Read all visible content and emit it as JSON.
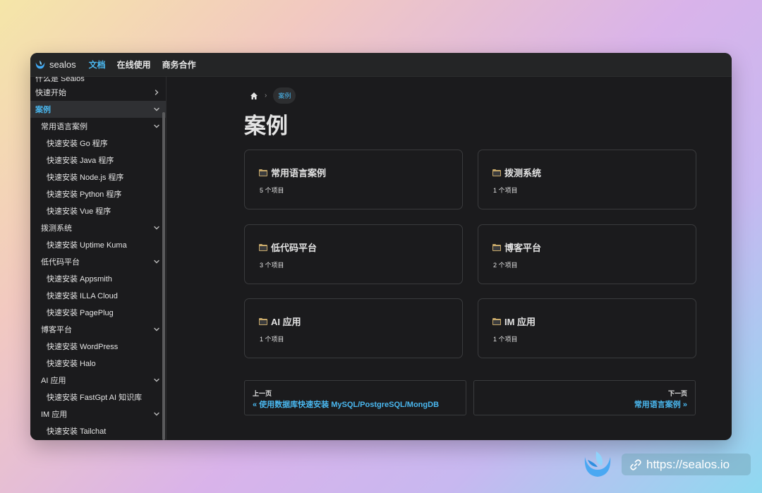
{
  "navbar": {
    "logo_text": "sealos",
    "links": [
      "文档",
      "在线使用",
      "商务合作"
    ]
  },
  "sidebar": {
    "items": [
      {
        "label": "什么是 Sealos",
        "level": 0,
        "chevron": "none",
        "partial": true
      },
      {
        "label": "快速开始",
        "level": 0,
        "chevron": "right"
      },
      {
        "label": "案例",
        "level": 0,
        "chevron": "down",
        "active": true
      },
      {
        "label": "常用语言案例",
        "level": 1,
        "chevron": "down"
      },
      {
        "label": "快速安装 Go 程序",
        "level": 2,
        "chevron": "none"
      },
      {
        "label": "快速安装 Java 程序",
        "level": 2,
        "chevron": "none"
      },
      {
        "label": "快速安装 Node.js 程序",
        "level": 2,
        "chevron": "none"
      },
      {
        "label": "快速安装 Python 程序",
        "level": 2,
        "chevron": "none"
      },
      {
        "label": "快速安装 Vue 程序",
        "level": 2,
        "chevron": "none"
      },
      {
        "label": "拨测系统",
        "level": 1,
        "chevron": "down"
      },
      {
        "label": "快速安装 Uptime Kuma",
        "level": 2,
        "chevron": "none"
      },
      {
        "label": "低代码平台",
        "level": 1,
        "chevron": "down"
      },
      {
        "label": "快速安装 Appsmith",
        "level": 2,
        "chevron": "none"
      },
      {
        "label": "快速安装 ILLA Cloud",
        "level": 2,
        "chevron": "none"
      },
      {
        "label": "快速安装 PagePlug",
        "level": 2,
        "chevron": "none"
      },
      {
        "label": "博客平台",
        "level": 1,
        "chevron": "down"
      },
      {
        "label": "快速安装 WordPress",
        "level": 2,
        "chevron": "none"
      },
      {
        "label": "快速安装 Halo",
        "level": 2,
        "chevron": "none"
      },
      {
        "label": "AI 应用",
        "level": 1,
        "chevron": "down"
      },
      {
        "label": "快速安装 FastGpt AI 知识库",
        "level": 2,
        "chevron": "none"
      },
      {
        "label": "IM 应用",
        "level": 1,
        "chevron": "down"
      },
      {
        "label": "快速安装 Tailchat",
        "level": 2,
        "chevron": "none"
      }
    ]
  },
  "breadcrumb": {
    "current": "案例",
    "separator": "›"
  },
  "page": {
    "title": "案例"
  },
  "cards": [
    {
      "title": "常用语言案例",
      "count": "5 个项目"
    },
    {
      "title": "拨测系统",
      "count": "1 个项目"
    },
    {
      "title": "低代码平台",
      "count": "3 个项目"
    },
    {
      "title": "博客平台",
      "count": "2 个项目"
    },
    {
      "title": "AI 应用",
      "count": "1 个项目"
    },
    {
      "title": "IM 应用",
      "count": "1 个项目"
    }
  ],
  "pager": {
    "prev_label": "上一页",
    "prev_link": "« 使用数据库快速安装 MySQL/PostgreSQL/MongDB",
    "next_label": "下一页",
    "next_link": "常用语言案例 »"
  },
  "footer": {
    "url": "https://sealos.io"
  },
  "colors": {
    "accent": "#4ab8f0",
    "background": "#1b1b1d",
    "text": "#e3e3e3"
  },
  "icons": {
    "logo": "sealos-logo-icon",
    "home": "home-icon",
    "folder": "folder-icon",
    "chevron_down": "chevron-down-icon",
    "chevron_right": "chevron-right-icon",
    "link": "link-icon"
  }
}
